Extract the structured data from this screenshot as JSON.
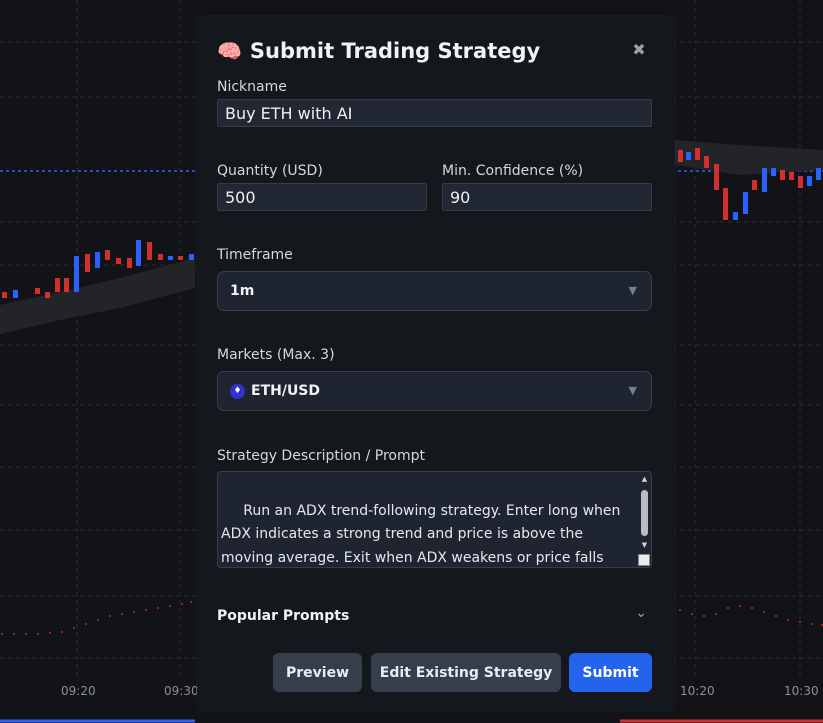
{
  "modal": {
    "title": "Submit Trading Strategy",
    "close_label": "✖",
    "fields": {
      "nickname": {
        "label": "Nickname",
        "value": "Buy ETH with AI"
      },
      "quantity": {
        "label": "Quantity (USD)",
        "value": "500"
      },
      "min_confidence": {
        "label": "Min. Confidence (%)",
        "value": "90"
      },
      "timeframe": {
        "label": "Timeframe",
        "value": "1m"
      },
      "markets": {
        "label": "Markets (Max. 3)",
        "value": "ETH/USD"
      },
      "prompt": {
        "label": "Strategy Description / Prompt",
        "value": " Run an ADX trend-following strategy. Enter long when ADX indicates a strong trend and price is above the moving average. Exit when ADX weakens or price falls below the moving average."
      }
    },
    "popular_prompts": {
      "title": "Popular Prompts"
    },
    "buttons": {
      "preview": "Preview",
      "edit_existing": "Edit Existing Strategy",
      "submit": "Submit"
    }
  },
  "background_chart": {
    "time_ticks": [
      "09:20",
      "09:30",
      "10:20",
      "10:30"
    ]
  },
  "colors": {
    "up_candle": "#2962ff",
    "down_candle": "#d32f2f",
    "accent": "#2463eb"
  }
}
